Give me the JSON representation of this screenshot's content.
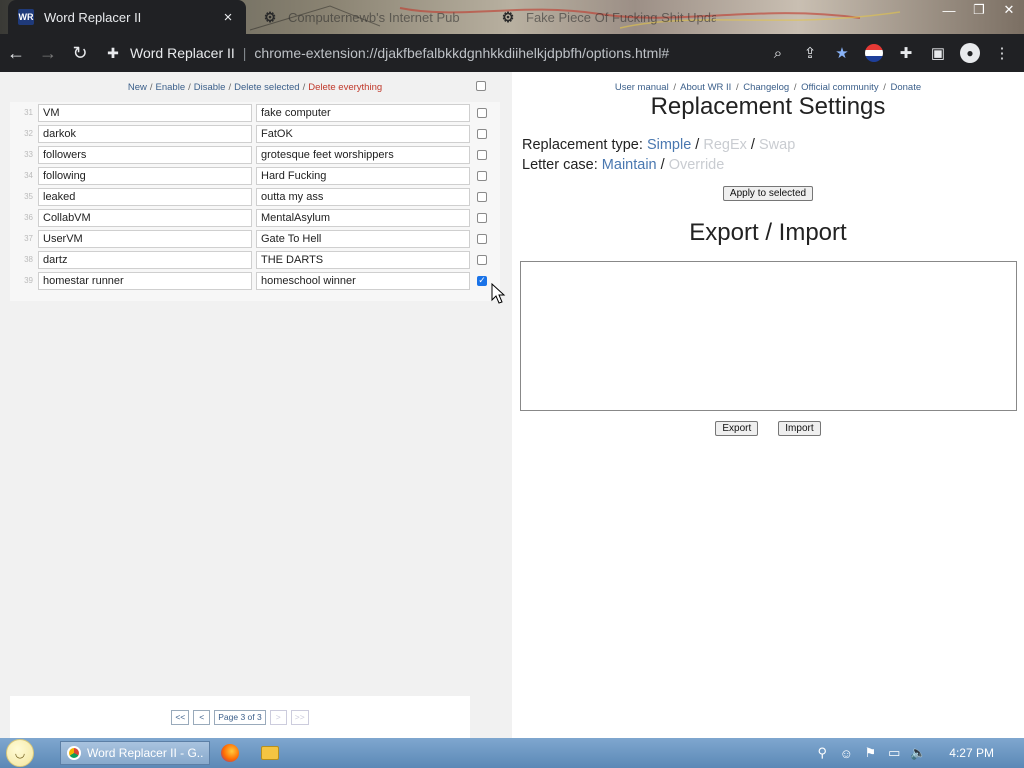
{
  "browser": {
    "tabs": [
      {
        "title": "Word Replacer II",
        "favicon": "WR",
        "active": true
      },
      {
        "title": "Computernewb's Internet Pub",
        "favicon": "computernewb-icon",
        "active": false
      },
      {
        "title": "Fake Piece Of Fucking Shit Upda",
        "favicon": "computernewb-icon",
        "active": false
      }
    ],
    "close_glyph": "×",
    "address": {
      "origin": "Word Replacer II",
      "separator": "|",
      "url": "chrome-extension://djakfbefalbkkdgnhkkdiihelkjdpbfh/options.html#"
    }
  },
  "left": {
    "actions": {
      "new": "New",
      "enable": "Enable",
      "disable": "Disable",
      "delete_selected": "Delete selected",
      "delete_everything": "Delete everything",
      "sep": "/"
    },
    "rows": [
      {
        "num": "31",
        "original": "VM",
        "replacement": "fake computer",
        "checked": false
      },
      {
        "num": "32",
        "original": "darkok",
        "replacement": "FatOK",
        "checked": false
      },
      {
        "num": "33",
        "original": "followers",
        "replacement": "grotesque feet worshippers",
        "checked": false
      },
      {
        "num": "34",
        "original": "following",
        "replacement": "Hard Fucking",
        "checked": false
      },
      {
        "num": "35",
        "original": "leaked",
        "replacement": "outta my ass",
        "checked": false
      },
      {
        "num": "36",
        "original": "CollabVM",
        "replacement": "MentalAsylum",
        "checked": false
      },
      {
        "num": "37",
        "original": "UserVM",
        "replacement": "Gate To Hell",
        "checked": false
      },
      {
        "num": "38",
        "original": "dartz",
        "replacement": "THE DARTS",
        "checked": false
      },
      {
        "num": "39",
        "original": "homestar runner",
        "replacement": "homeschool winner",
        "checked": true
      }
    ],
    "pager": {
      "first": "<<",
      "prev": "<",
      "label": "Page 3 of 3",
      "next": ">",
      "last": ">>"
    }
  },
  "right": {
    "links": {
      "manual": "User manual",
      "about": "About WR II",
      "changelog": "Changelog",
      "community": "Official community",
      "donate": "Donate",
      "sep": "/"
    },
    "settings_title": "Replacement Settings",
    "type_label": "Replacement type:",
    "type_options": {
      "simple": "Simple",
      "regex": "RegEx",
      "swap": "Swap",
      "selected": "Simple"
    },
    "case_label": "Letter case:",
    "case_options": {
      "maintain": "Maintain",
      "override": "Override",
      "selected": "Maintain"
    },
    "apply_button": "Apply to selected",
    "export_title": "Export / Import",
    "textarea_value": "",
    "export_button": "Export",
    "import_button": "Import"
  },
  "taskbar": {
    "active_task": "Word Replacer II - G...",
    "clock": "4:27 PM"
  },
  "colors": {
    "link": "#3b5f8a",
    "danger": "#c0392b",
    "option_active": "#4a78b0",
    "option_inactive": "#c9ccd1",
    "checkbox_checked": "#1a73e8",
    "chrome_dark": "#202124"
  }
}
